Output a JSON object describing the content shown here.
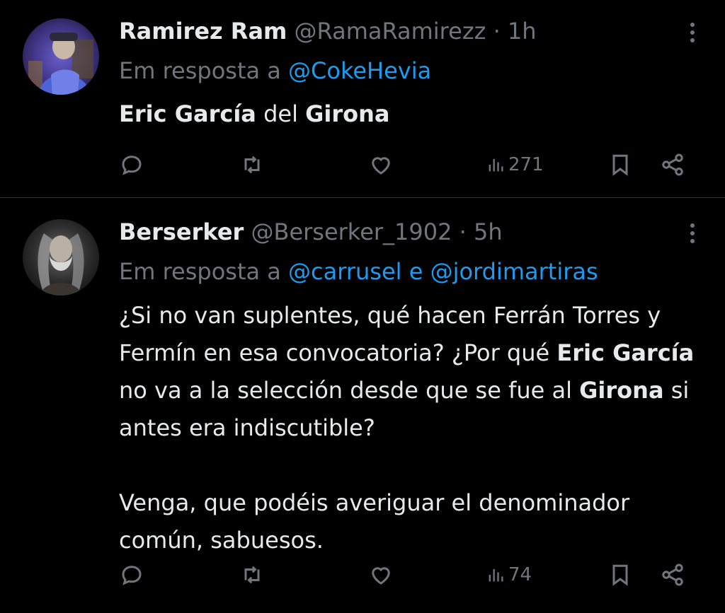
{
  "tweets": [
    {
      "name": "Ramirez Ram",
      "handle": "@RamaRamirezz",
      "separator": "·",
      "time": "1h",
      "reply_prefix": "Em resposta a",
      "reply_mentions": [
        "@CokeHevia"
      ],
      "body": {
        "bold1": "Eric García",
        "text1": " del ",
        "bold2": "Girona"
      },
      "stats": {
        "views": "271"
      }
    },
    {
      "name": "Berserker",
      "handle": "@Berserker_1902",
      "separator": "·",
      "time": "5h",
      "reply_prefix": "Em resposta a",
      "reply_mentions": [
        "@carrusel",
        "@jordimartiras"
      ],
      "reply_joiner": "e",
      "body": {
        "p1_a": "¿Si no van suplentes, qué hacen Ferrán Torres y Fermín en esa convocatoria? ¿Por qué ",
        "p1_b1": "Eric García",
        "p1_c": " no va a la selección desde que se fue al ",
        "p1_b2": "Girona",
        "p1_d": " si antes era indiscutible?",
        "p2": "Venga, que podéis averiguar el denominador común, sabuesos."
      },
      "stats": {
        "views": "74"
      }
    }
  ],
  "icons": {
    "reply": "reply-icon",
    "retweet": "retweet-icon",
    "like": "heart-icon",
    "views": "views-icon",
    "bookmark": "bookmark-icon",
    "share": "share-icon",
    "more": "more-icon"
  },
  "colors": {
    "background": "#000000",
    "text": "#e7e9ea",
    "secondary": "#71767b",
    "link": "#1d9bf0",
    "divider": "#2f3336"
  }
}
